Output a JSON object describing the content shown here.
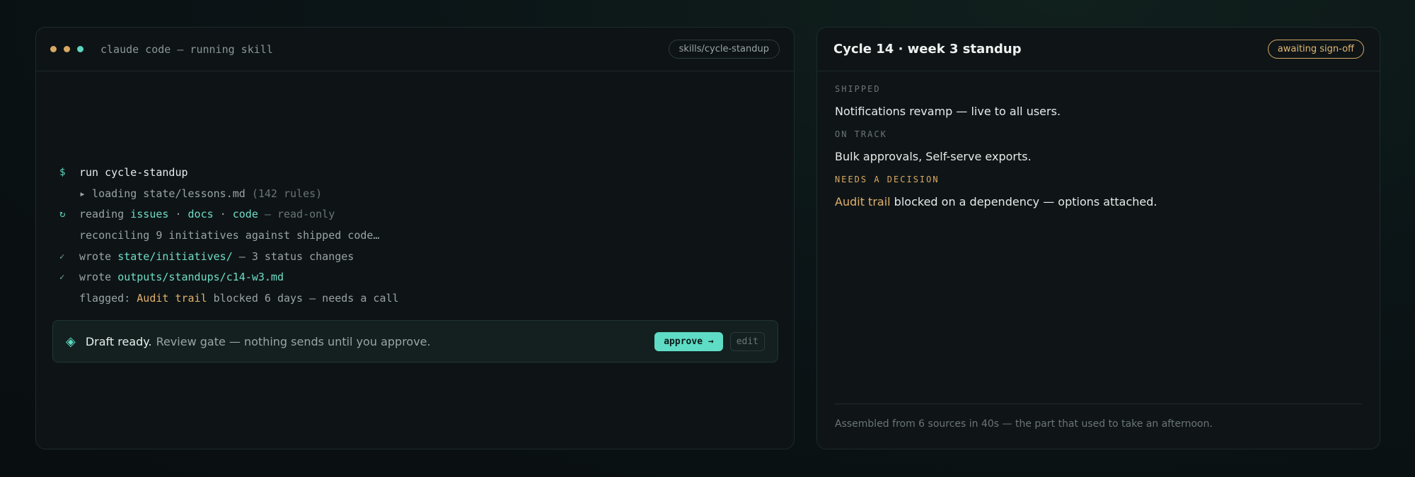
{
  "terminal": {
    "title": "claude code — running skill",
    "chip": "skills/cycle-standup",
    "dot_colors": [
      "#d9a962",
      "#d9a962",
      "#5ed6c0"
    ],
    "lines": [
      {
        "gutter": "$",
        "cmd": "run cycle-standup"
      },
      {
        "text": "▸ loading state/lessons.md",
        "muted": "(142 rules)"
      },
      {
        "gutter": "↻",
        "pre": "reading ",
        "t1": "issues",
        "sep1": " · ",
        "t2": "docs",
        "sep2": " · ",
        "t3": "code",
        "muted": " — read-only"
      },
      {
        "text": "reconciling 9 initiatives against shipped code…"
      },
      {
        "gutter": "✓",
        "pre": "wrote ",
        "teal": "state/initiatives/",
        "post": " — 3 status changes"
      },
      {
        "gutter": "✓",
        "pre": "wrote ",
        "teal": "outputs/standups/c14-w3.md"
      },
      {
        "pre": "flagged: ",
        "amber": "Audit trail",
        "post": " blocked 6 days — needs a call"
      }
    ],
    "draft": {
      "icon": "◈",
      "strong": "Draft ready.",
      "rest": "Review gate — nothing sends until you approve.",
      "approve_label": "approve →",
      "edit_label": "edit"
    }
  },
  "standup": {
    "title": "Cycle 14 · week 3 standup",
    "badge": "awaiting sign-off",
    "sections": [
      {
        "label": "SHIPPED",
        "text": "Notifications revamp — live to all users."
      },
      {
        "label": "ON TRACK",
        "text": "Bulk approvals, Self-serve exports."
      },
      {
        "label": "NEEDS A DECISION",
        "highlight": "Audit trail",
        "text": " blocked on a dependency — options attached."
      }
    ],
    "footer": "Assembled from 6 sources in 40s — the part that used to take an afternoon."
  }
}
